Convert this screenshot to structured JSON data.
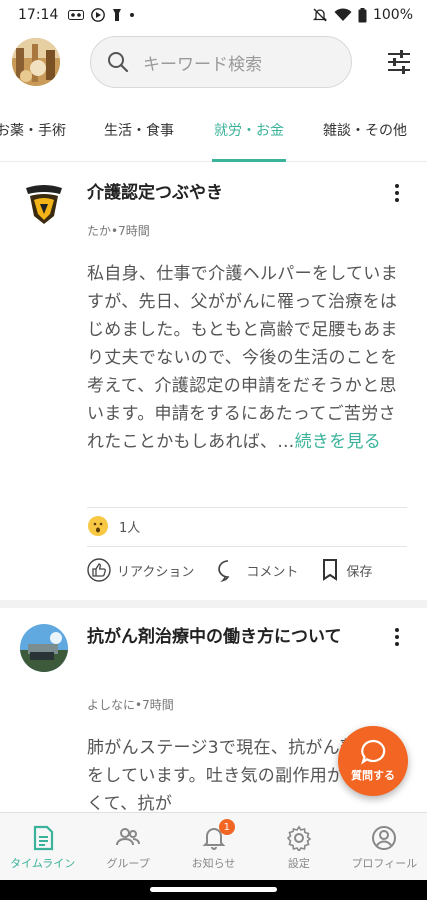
{
  "status_bar": {
    "time": "17:14",
    "battery": "100%",
    "icons": [
      "voicemail-icon",
      "media-icon",
      "flashlight-icon",
      "dot-icon",
      "mute-icon",
      "wifi-icon",
      "battery-icon"
    ]
  },
  "search": {
    "placeholder": "キーワード検索"
  },
  "tabs": [
    {
      "label": "お薬・手術"
    },
    {
      "label": "生活・食事"
    },
    {
      "label": "就労・お金"
    },
    {
      "label": "雑談・その他"
    }
  ],
  "active_tab": "就労・お金",
  "colors": {
    "accent": "#3ab39a",
    "fab": "#f26522"
  },
  "posts": [
    {
      "title": "介護認定つぶやき",
      "meta": "たか•7時間",
      "body": "私自身、仕事で介護ヘルパーをしていますが、先日、父ががんに罹って治療をはじめました。もともと高齢で足腰もあまり丈夫でないので、今後の生活のことを考えて、介護認定の申請をだそうかと思います。申請をするにあたってご苦労されたことかもしあれば、…",
      "more": "続きを見る",
      "reaction_count": "1人",
      "actions": {
        "reaction": "リアクション",
        "comment": "コメント",
        "save": "保存"
      }
    },
    {
      "title": "抗がん剤治療中の働き方について",
      "meta": "よしなに•7時間",
      "body": "肺がんステージ3で現在、抗がん剤治療をしています。吐き気の副作用がはげしくて、抗が"
    }
  ],
  "fab": {
    "label": "質問する"
  },
  "bottom_nav": [
    {
      "label": "タイムライン",
      "icon": "timeline-icon"
    },
    {
      "label": "グループ",
      "icon": "group-icon"
    },
    {
      "label": "お知らせ",
      "icon": "bell-icon",
      "badge": "1"
    },
    {
      "label": "設定",
      "icon": "gear-icon"
    },
    {
      "label": "プロフィール",
      "icon": "profile-icon"
    }
  ]
}
